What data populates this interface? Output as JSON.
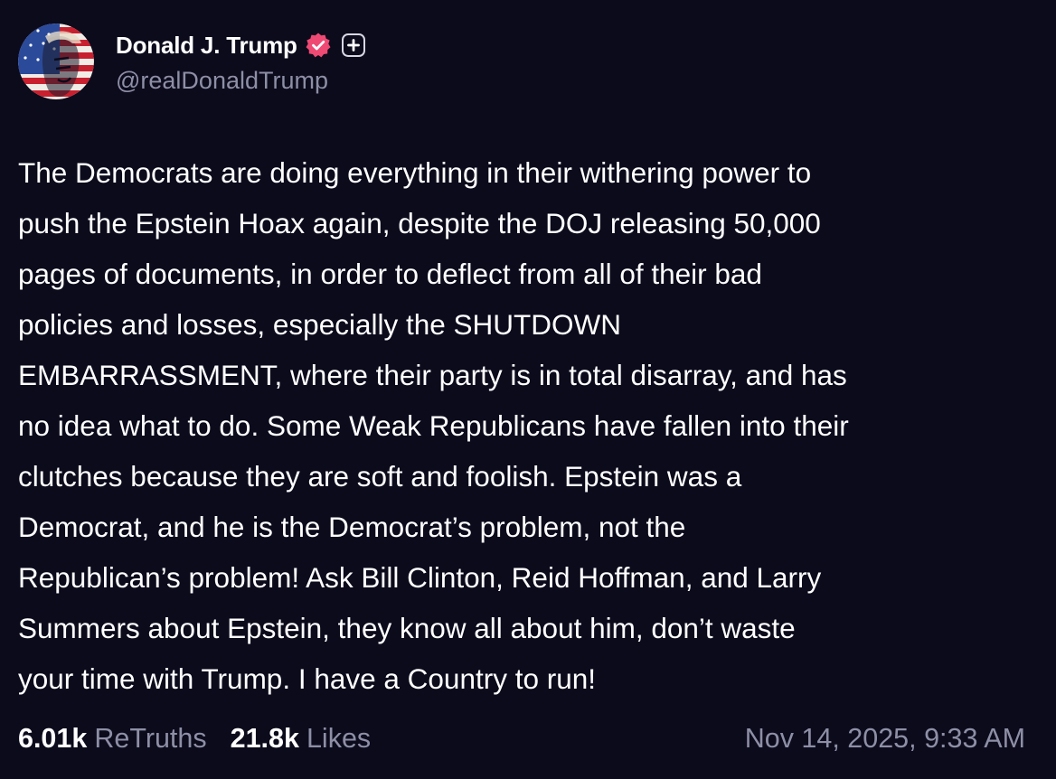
{
  "author": {
    "display_name": "Donald J. Trump",
    "handle": "@realDonaldTrump",
    "avatar_icon": "profile-avatar",
    "verified_icon": "verified-badge-icon",
    "plus_icon": "plus-icon"
  },
  "post": {
    "text": "The Democrats are doing everything in their withering power to\npush the Epstein Hoax again, despite the DOJ releasing 50,000\npages of documents, in order to deflect from all of their bad\npolicies and losses, especially the SHUTDOWN\nEMBARRASSMENT, where their party is in total disarray, and has\nno idea what to do. Some Weak Republicans have fallen into their\nclutches because they are soft and foolish. Epstein was a\nDemocrat, and he is the Democrat’s problem, not the\nRepublican’s problem! Ask Bill Clinton, Reid Hoffman, and Larry\nSummers about Epstein, they know all about him, don’t waste\nyour time with Trump. I have a Country to run!"
  },
  "stats": {
    "retruths_count": "6.01k",
    "retruths_label": "ReTruths",
    "likes_count": "21.8k",
    "likes_label": "Likes",
    "timestamp": "Nov 14, 2025, 9:33 AM"
  },
  "colors": {
    "background": "#0b0b1c",
    "text_primary": "#ffffff",
    "text_secondary": "#8e8ea6",
    "verified_badge": "#ee4a73"
  }
}
